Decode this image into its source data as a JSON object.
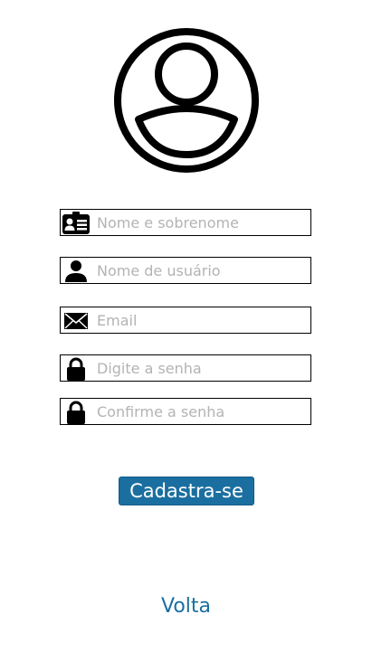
{
  "header": {
    "avatar_icon": "user-circle-icon"
  },
  "form": {
    "fields": [
      {
        "icon": "id-card-icon",
        "placeholder": "Nome e sobrenome",
        "value": ""
      },
      {
        "icon": "person-icon",
        "placeholder": "Nome de usuário",
        "value": ""
      },
      {
        "icon": "envelope-icon",
        "placeholder": "Email",
        "value": ""
      },
      {
        "icon": "lock-icon",
        "placeholder": "Digite a senha",
        "value": ""
      },
      {
        "icon": "lock-icon",
        "placeholder": "Confirme a senha",
        "value": ""
      }
    ],
    "submit_label": "Cadastra-se"
  },
  "footer": {
    "back_label": "Volta"
  },
  "colors": {
    "accent": "#1b6fa0",
    "border": "#000000",
    "placeholder": "#b3b3b3"
  }
}
